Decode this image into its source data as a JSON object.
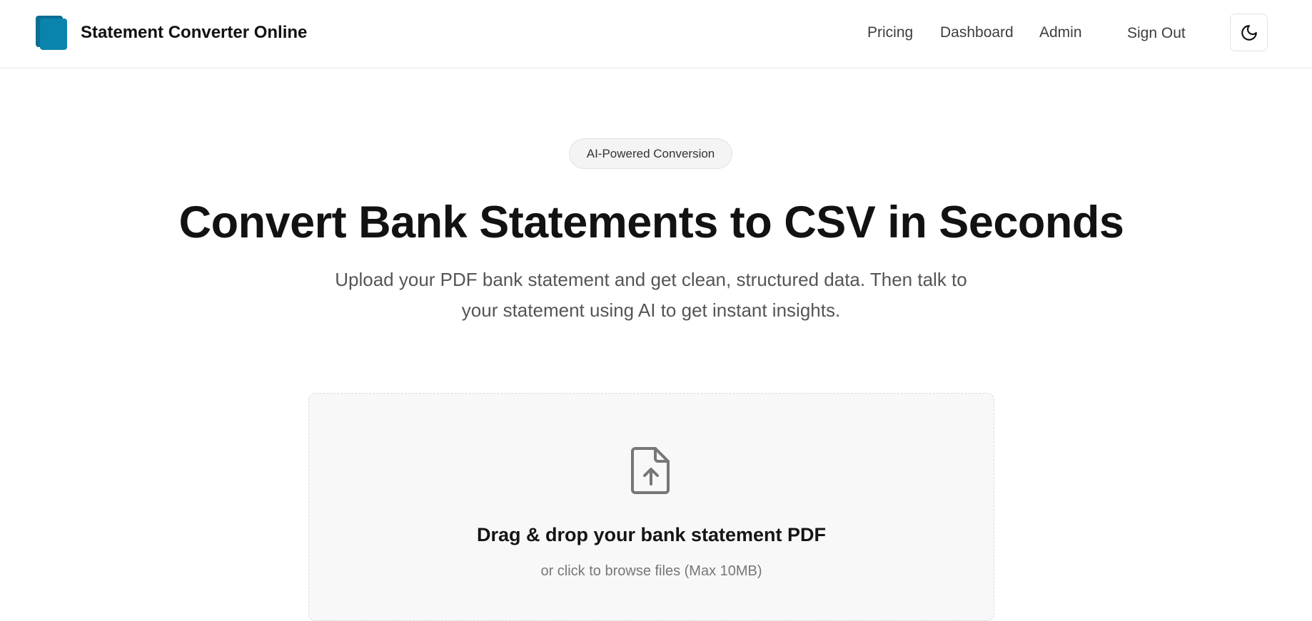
{
  "header": {
    "brand_name": "Statement Converter Online",
    "nav": {
      "pricing": "Pricing",
      "dashboard": "Dashboard",
      "admin": "Admin",
      "sign_out": "Sign Out"
    },
    "theme_toggle_icon": "moon-icon"
  },
  "hero": {
    "badge": "AI-Powered Conversion",
    "title": "Convert Bank Statements to CSV in Seconds",
    "subtitle": "Upload your PDF bank statement and get clean, structured data. Then talk to your statement using AI to get instant insights."
  },
  "upload": {
    "icon": "file-upload-icon",
    "title": "Drag & drop your bank statement PDF",
    "hint": "or click to browse files (Max 10MB)"
  },
  "colors": {
    "brand": "#0a84ad",
    "brand_dark": "#0a6f92"
  }
}
